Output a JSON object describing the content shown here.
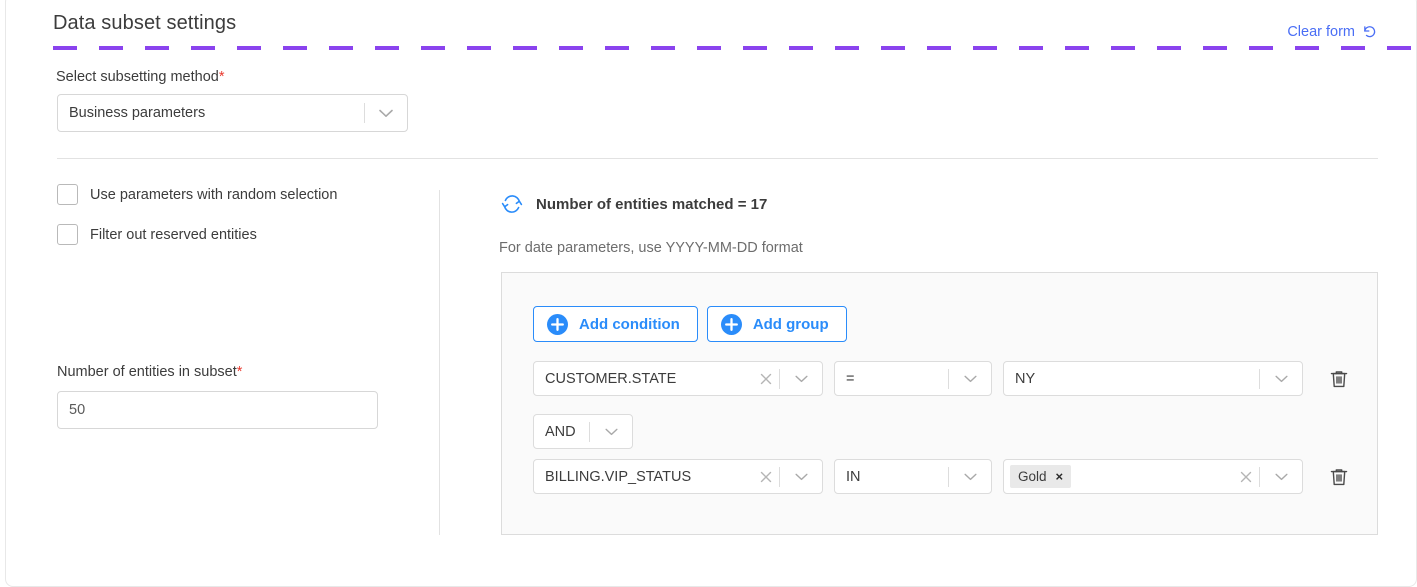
{
  "header": {
    "title": "Data subset settings",
    "clear_form_label": "Clear form",
    "clear_form_icon": "refresh-undo-icon"
  },
  "method": {
    "label": "Select subsetting method",
    "required_mark": "*",
    "value": "Business parameters",
    "chevron_icon": "chevron-down-icon"
  },
  "options": {
    "checkbox_random": {
      "label": "Use parameters with random selection",
      "checked": false
    },
    "checkbox_reserved": {
      "label": "Filter out reserved entities",
      "checked": false
    },
    "entities_count": {
      "label": "Number of entities in subset",
      "required_mark": "*",
      "value": "50"
    }
  },
  "query": {
    "matched_text": "Number of entities matched = 17",
    "matched_icon": "refresh-icon",
    "hint": "For date parameters, use YYYY-MM-DD format",
    "add_condition_label": "Add condition",
    "add_group_label": "Add group",
    "plus_icon": "plus-circle-icon",
    "clear_icon": "close-x-icon",
    "chevron_icon": "chevron-down-icon",
    "delete_icon": "trash-icon",
    "conditions": [
      {
        "field": "CUSTOMER.STATE",
        "operator": "=",
        "value": "NY",
        "value_type": "text"
      },
      {
        "field": "BILLING.VIP_STATUS",
        "operator": "IN",
        "value_type": "chips",
        "chips": [
          "Gold"
        ],
        "chip_remove_label": "×"
      }
    ],
    "logical_operator": "AND"
  },
  "colors": {
    "accent_purple": "#8a43ee",
    "link_blue": "#4a6ef5",
    "button_blue": "#2a8cfa",
    "required_red": "#e8392e",
    "chip_bg": "#e9e9e9"
  }
}
